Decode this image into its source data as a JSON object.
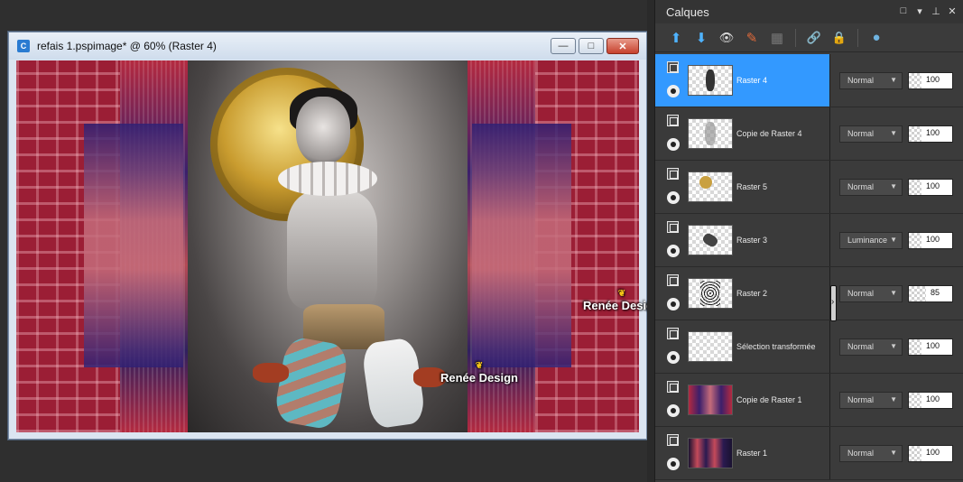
{
  "document": {
    "icon_label": "C",
    "title": "refais 1.pspimage* @  60% (Raster 4)",
    "min_label": "—",
    "max_label": "□",
    "close_label": "✕",
    "watermark1": "Renée Design",
    "watermark2": "Renée Design",
    "butterfly": "❦"
  },
  "layers_panel": {
    "title": "Calques",
    "ctrl_restore": "□",
    "ctrl_menu": "▾",
    "ctrl_pin": "⊥",
    "ctrl_close": "✕",
    "toolbar": [
      {
        "name": "new-raster-layer-icon",
        "glyph": "⬆"
      },
      {
        "name": "merge-down-icon",
        "glyph": "⬇"
      },
      {
        "name": "layer-visibility-icon",
        "glyph": "👁"
      },
      {
        "name": "edit-selection-icon",
        "glyph": "✎"
      },
      {
        "name": "delete-layer-icon",
        "glyph": "▦"
      },
      {
        "name": "link-layer-icon",
        "glyph": "🔗"
      },
      {
        "name": "lock-layer-icon",
        "glyph": "🔒"
      },
      {
        "name": "blend-ranges-icon",
        "glyph": "●"
      }
    ],
    "layers": [
      {
        "name": "Raster 4",
        "blend": "Normal",
        "opacity": 100,
        "active": true
      },
      {
        "name": "Copie de Raster 4",
        "blend": "Normal",
        "opacity": 100,
        "active": false
      },
      {
        "name": "Raster 5",
        "blend": "Normal",
        "opacity": 100,
        "active": false
      },
      {
        "name": "Raster 3",
        "blend": "Luminance",
        "opacity": 100,
        "active": false
      },
      {
        "name": "Raster 2",
        "blend": "Normal",
        "opacity": 85,
        "active": false
      },
      {
        "name": "Sélection transformée",
        "blend": "Normal",
        "opacity": 100,
        "active": false
      },
      {
        "name": "Copie de Raster 1",
        "blend": "Normal",
        "opacity": 100,
        "active": false
      },
      {
        "name": "Raster 1",
        "blend": "Normal",
        "opacity": 100,
        "active": false
      }
    ]
  }
}
